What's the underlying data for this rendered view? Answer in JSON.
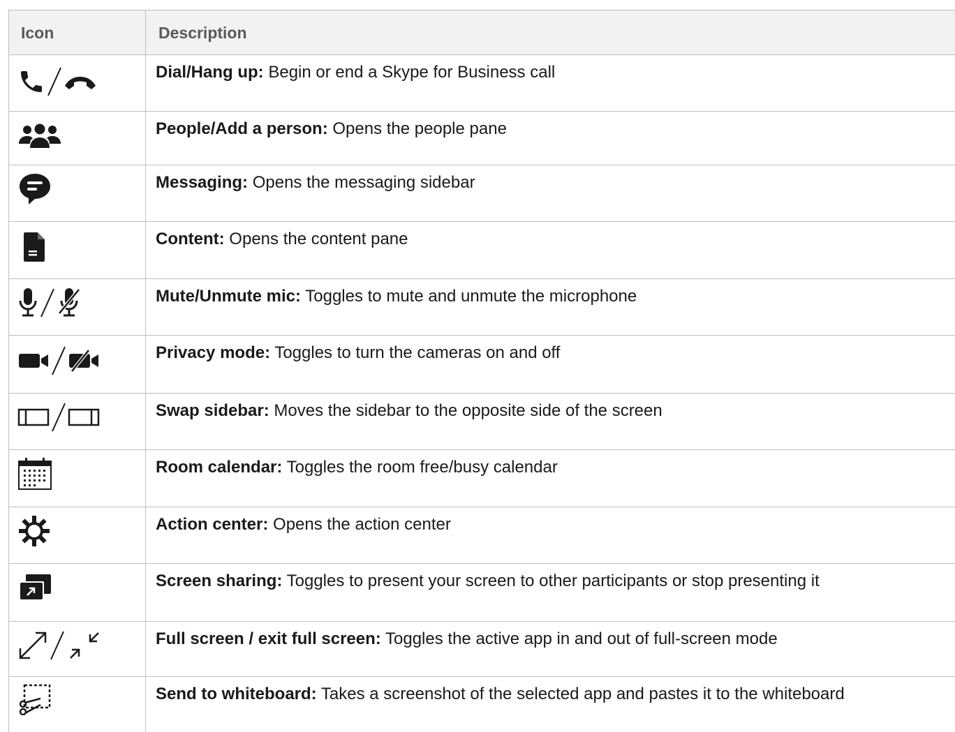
{
  "table": {
    "header": {
      "icon": "Icon",
      "description": "Description"
    },
    "rows": [
      {
        "label": "Dial/Hang up:",
        "text": " Begin or end a Skype for Business call",
        "icons": [
          "phone-icon",
          "hang-up-icon"
        ]
      },
      {
        "label": "People/Add a person:",
        "text": " Opens the people pane",
        "icons": [
          "people-icon"
        ]
      },
      {
        "label": "Messaging:",
        "text": " Opens the messaging sidebar",
        "icons": [
          "chat-bubble-icon"
        ]
      },
      {
        "label": "Content:",
        "text": " Opens the content pane",
        "icons": [
          "document-icon"
        ]
      },
      {
        "label": "Mute/Unmute mic:",
        "text": " Toggles to mute and unmute the microphone",
        "icons": [
          "microphone-icon",
          "microphone-off-icon"
        ]
      },
      {
        "label": "Privacy mode:",
        "text": " Toggles to turn the cameras on and off",
        "icons": [
          "camera-icon",
          "camera-off-icon"
        ]
      },
      {
        "label": "Swap sidebar:",
        "text": " Moves the sidebar to the opposite side of the screen",
        "icons": [
          "sidebar-left-icon",
          "sidebar-right-icon"
        ]
      },
      {
        "label": "Room calendar:",
        "text": " Toggles the room free/busy calendar",
        "icons": [
          "calendar-icon"
        ]
      },
      {
        "label": "Action center:",
        "text": " Opens the action center",
        "icons": [
          "gear-icon"
        ]
      },
      {
        "label": "Screen sharing:",
        "text": " Toggles to present your screen to other participants or stop presenting it",
        "icons": [
          "screen-share-icon"
        ]
      },
      {
        "label": "Full screen / exit full screen:",
        "text": " Toggles the active app in and out of full-screen mode",
        "icons": [
          "expand-icon",
          "collapse-icon"
        ]
      },
      {
        "label": "Send to whiteboard:",
        "text": " Takes a screenshot of the selected app and pastes it to the whiteboard",
        "icons": [
          "snip-to-whiteboard-icon"
        ]
      }
    ]
  },
  "colors": {
    "border": "#bfbfbf",
    "header_bg": "#f2f2f2",
    "header_text": "#595959",
    "icon": "#1a1a1a"
  }
}
